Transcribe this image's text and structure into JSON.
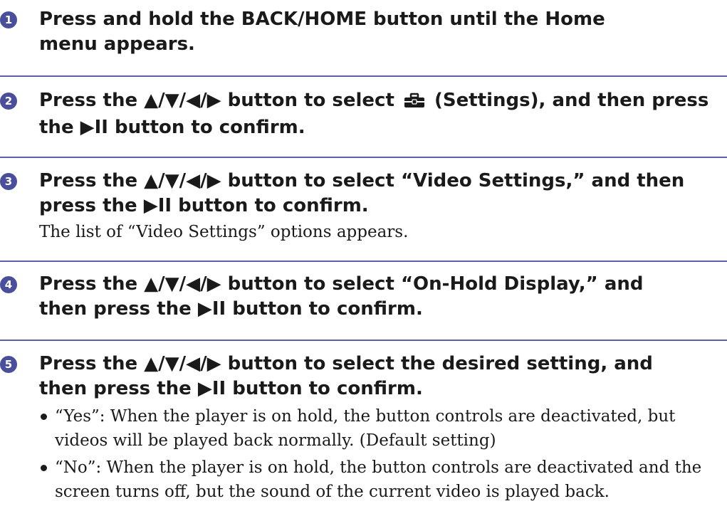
{
  "steps": [
    {
      "number": "1",
      "title": "Press and hold the BACK/HOME button until the Home menu appears."
    },
    {
      "number": "2",
      "title_part1": "Press the ▲/▼/◀/▶ button to select",
      "icon": "toolbox-icon",
      "title_part2": "(Settings), and then press the ▶II button to confirm."
    },
    {
      "number": "3",
      "title": "Press the ▲/▼/◀/▶ button to select “Video Settings,” and then press the ▶II button to confirm.",
      "description": "The list of “Video Settings” options appears."
    },
    {
      "number": "4",
      "title": "Press the ▲/▼/◀/▶ button to select “On-Hold Display,” and then press the ▶II button to confirm."
    },
    {
      "number": "5",
      "title": "Press the ▲/▼/◀/▶ button to select the desired setting, and then press the ▶II button to confirm.",
      "bullets": [
        "“Yes”: When the player is on hold, the button controls are deactivated, but videos will be played back normally. (Default setting)",
        "“No”: When the player is on hold, the button controls are deactivated and the screen turns off, but the sound of the current video is played back."
      ]
    }
  ],
  "colors": {
    "accent": "#4a4f9c",
    "divider": "#5b5fa8",
    "text": "#1a1a1a"
  }
}
